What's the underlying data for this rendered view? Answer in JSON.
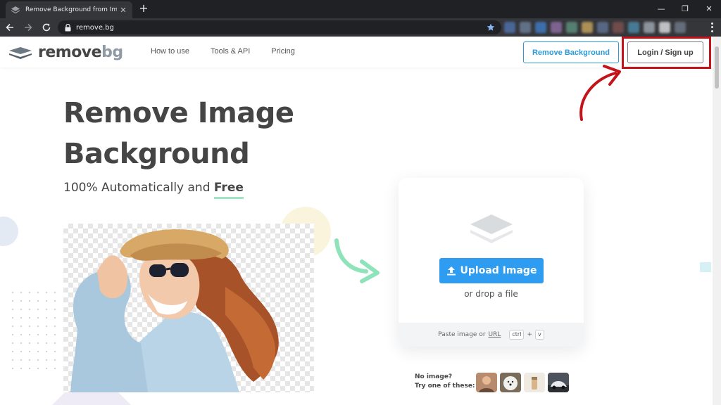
{
  "browser": {
    "tab_title": "Remove Background from Image",
    "url": "remove.bg",
    "new_tab": "+",
    "window_controls": [
      "—",
      "❐",
      "✕"
    ]
  },
  "site": {
    "logo": {
      "main": "remove",
      "suffix": "bg"
    },
    "nav": [
      "How to use",
      "Tools & API",
      "Pricing"
    ],
    "remove_bg_button": "Remove Background",
    "login_button": "Login / Sign up"
  },
  "hero": {
    "title_line1": "Remove Image",
    "title_line2": "Background",
    "subtitle_prefix": "100% Automatically and ",
    "subtitle_free": "Free"
  },
  "upload": {
    "button": "Upload Image",
    "drop": "or drop a file",
    "paste_prefix": "Paste image or ",
    "paste_url": "URL",
    "key_ctrl": "ctrl",
    "key_plus": "+",
    "key_v": "v"
  },
  "samples": {
    "line1": "No image?",
    "line2": "Try one of these:"
  },
  "colors": {
    "accent_blue": "#2e9cf0",
    "highlight_red": "#c4141b",
    "accent_green": "#9ee6c3",
    "text_dark": "#454545"
  }
}
